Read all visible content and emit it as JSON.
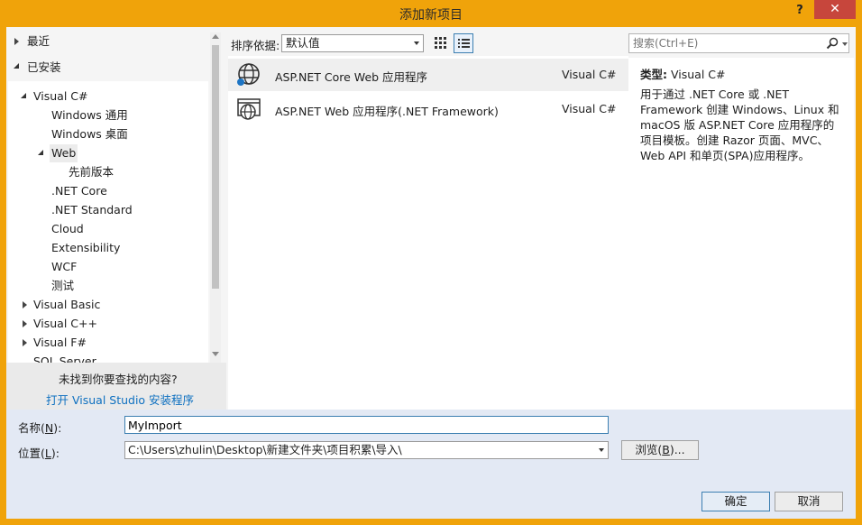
{
  "window": {
    "title": "添加新项目",
    "help_label": "?",
    "close_label": "✕"
  },
  "tree": {
    "recent": "最近",
    "installed": "已安装",
    "visual_csharp": "Visual C#",
    "windows_universal": "Windows 通用",
    "windows_desktop": "Windows 桌面",
    "web": "Web",
    "previous_version": "先前版本",
    "net_core": ".NET Core",
    "net_standard": ".NET Standard",
    "cloud": "Cloud",
    "extensibility": "Extensibility",
    "wcf": "WCF",
    "test": "测试",
    "visual_basic": "Visual Basic",
    "visual_cpp": "Visual C++",
    "visual_fsharp": "Visual F#",
    "sql_server": "SQL Server"
  },
  "not_found": {
    "question": "未找到你要查找的内容?",
    "link": "打开 Visual Studio 安装程序"
  },
  "toolbar": {
    "sort_label": "排序依据:",
    "sort_value": "默认值"
  },
  "search": {
    "placeholder": "搜索(Ctrl+E)"
  },
  "templates": [
    {
      "name": "ASP.NET Core Web 应用程序",
      "lang": "Visual C#",
      "icon": "globe-core-icon"
    },
    {
      "name": "ASP.NET Web 应用程序(.NET Framework)",
      "lang": "Visual C#",
      "icon": "globe-framework-icon"
    }
  ],
  "description": {
    "type_label": "类型:",
    "type_value": "Visual C#",
    "text": "用于通过 .NET Core 或 .NET Framework 创建 Windows、Linux 和 macOS 版 ASP.NET Core 应用程序的项目模板。创建 Razor 页面、MVC、Web API 和单页(SPA)应用程序。"
  },
  "form": {
    "name_label_pre": "名称(",
    "name_label_key": "N",
    "name_label_post": "):",
    "name_value": "MyImport",
    "location_label_pre": "位置(",
    "location_label_key": "L",
    "location_label_post": "):",
    "location_value": "C:\\Users\\zhulin\\Desktop\\新建文件夹\\项目积累\\导入\\",
    "browse_pre": "浏览(",
    "browse_key": "B",
    "browse_post": ")...",
    "ok": "确定",
    "cancel": "取消"
  },
  "colors": {
    "title_bar": "#f0a30a",
    "close_button": "#c7463c",
    "link": "#0e70c0",
    "accent_border": "#3c7fb1"
  }
}
